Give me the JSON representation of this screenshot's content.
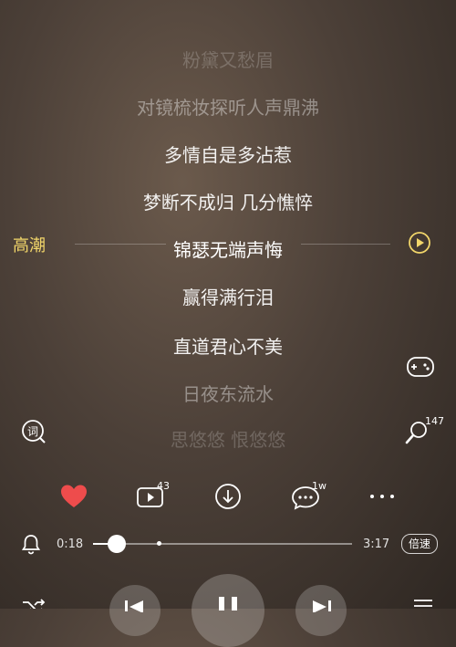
{
  "lyrics": [
    "粉黛又愁眉",
    "对镜梳妆探听人声鼎沸",
    "多情自是多沾惹",
    "梦断不成归 几分憔悴",
    "锦瑟无端声悔",
    "赢得满行泪",
    "直道君心不美",
    "日夜东流水",
    "思悠悠 恨悠悠"
  ],
  "highlight_label": "高潮",
  "actions": {
    "like_count": "",
    "comment_video_count": "43",
    "comments_count": "1w",
    "sleep_count": "147"
  },
  "player": {
    "elapsed": "0:18",
    "total": "3:17",
    "progress": 0.092,
    "speed_label": "倍速"
  },
  "colors": {
    "accent": "#f2d66a",
    "like": "#ee4c4c"
  }
}
